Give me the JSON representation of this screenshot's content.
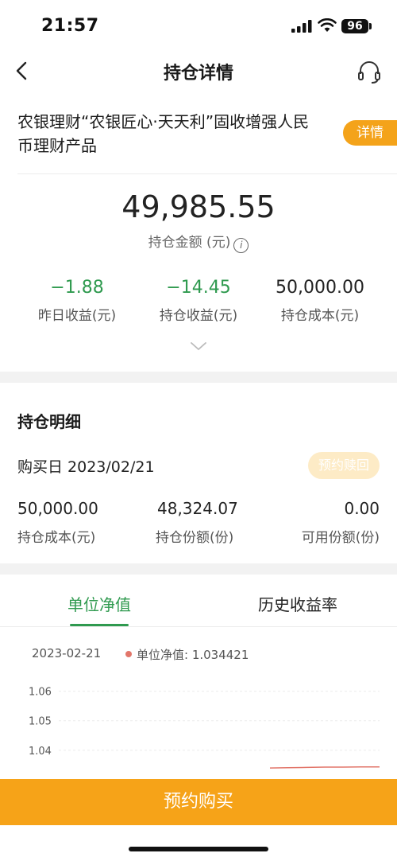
{
  "status_bar": {
    "time": "21:57",
    "battery": "96"
  },
  "nav": {
    "title": "持仓详情",
    "back_icon": "chevron-left-icon",
    "support_icon": "headset-icon"
  },
  "product": {
    "name": "农银理财“农银匠心·天天利”固收增强人民币理财产品",
    "detail_button": "详情"
  },
  "summary": {
    "amount": "49,985.55",
    "amount_label": "持仓金额 (元)",
    "stats": [
      {
        "value": "−1.88",
        "label": "昨日收益(元)"
      },
      {
        "value": "−14.45",
        "label": "持仓收益(元)"
      },
      {
        "value": "50,000.00",
        "label": "持仓成本(元)"
      }
    ]
  },
  "holding_details": {
    "title": "持仓明细",
    "purchase_date": "购买日 2023/02/21",
    "redeem_button": "预约赎回",
    "items": [
      {
        "value": "50,000.00",
        "label": "持仓成本(元)"
      },
      {
        "value": "48,324.07",
        "label": "持仓份额(份)"
      },
      {
        "value": "0.00",
        "label": "可用份额(份)"
      }
    ]
  },
  "tabs": [
    {
      "label": "单位净值",
      "active": true
    },
    {
      "label": "历史收益率",
      "active": false
    }
  ],
  "chart_data": {
    "type": "line",
    "tooltip_date": "2023-02-21",
    "legend": "单位净值: 1.034421",
    "y_ticks": [
      "1.06",
      "1.05",
      "1.04"
    ],
    "ylim": [
      1.03,
      1.065
    ],
    "series": [
      {
        "name": "单位净值",
        "color": "#e2766a",
        "values": [
          1.034,
          1.0341,
          1.0342,
          1.0343,
          1.0343,
          1.0344,
          1.0344
        ]
      }
    ],
    "grid": true
  },
  "bottom": {
    "buy_button": "预约购买"
  },
  "colors": {
    "accent_green": "#2f9a4f",
    "accent_orange": "#f6a318"
  }
}
